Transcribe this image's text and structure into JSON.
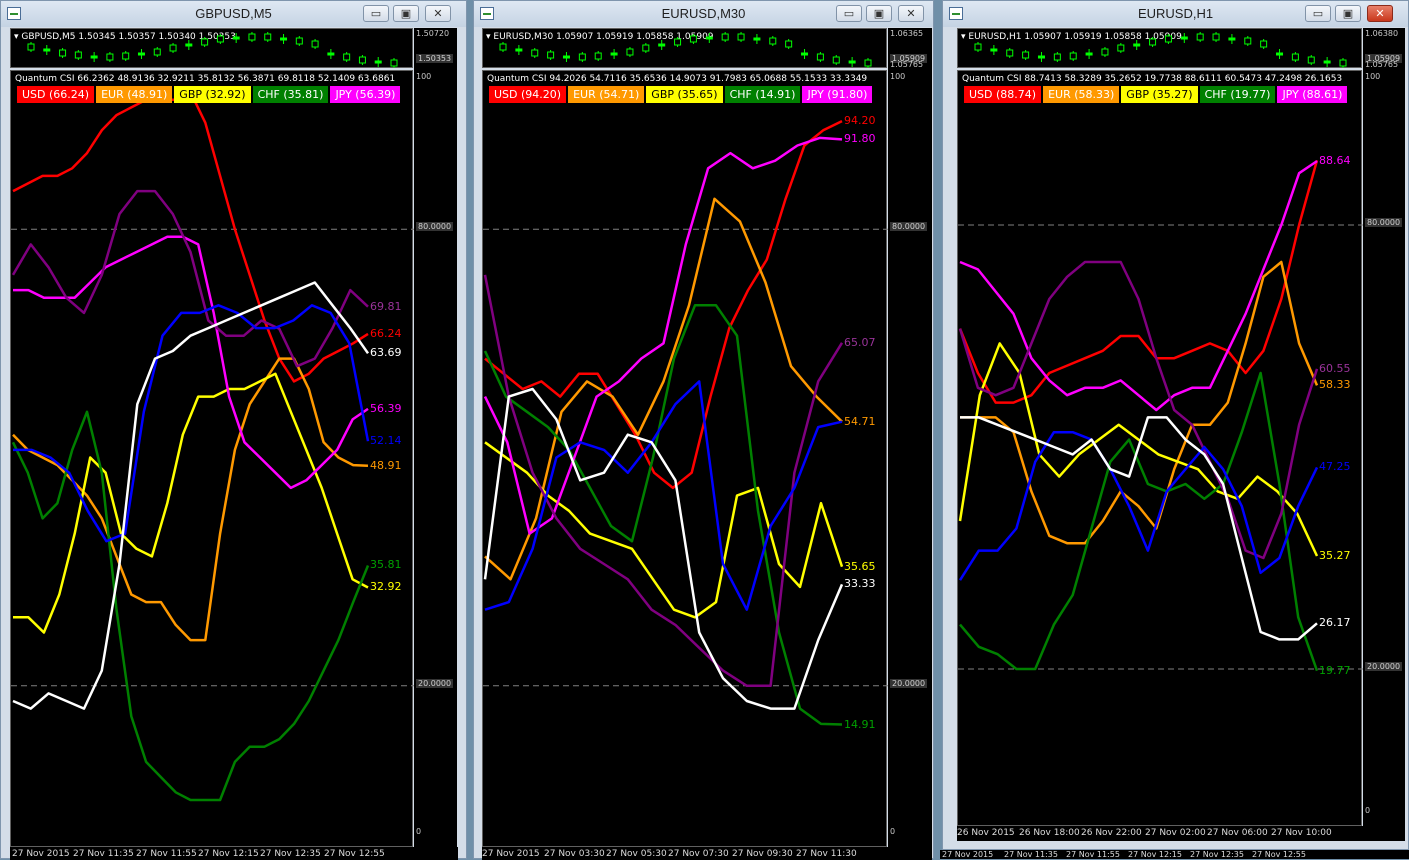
{
  "windows": [
    {
      "title": "GBPUSD,M5",
      "symbol_line": "GBPUSD,M5  1.50345 1.50357 1.50340 1.50353",
      "price_scale": [
        "1.50720",
        "1.50353"
      ],
      "csi_line": "Quantum CSI 66.2362 48.9136 32.9211 35.8132 56.3871 69.8118 52.1409 63.6861",
      "legend": [
        {
          "label": "USD (66.24)",
          "bg": "#ff0000",
          "fg": "#ffffff"
        },
        {
          "label": "EUR (48.91)",
          "bg": "#ff9900",
          "fg": "#ffffff"
        },
        {
          "label": "GBP (32.92)",
          "bg": "#ffff00",
          "fg": "#000000"
        },
        {
          "label": "CHF (35.81)",
          "bg": "#008000",
          "fg": "#ffffff"
        },
        {
          "label": "JPY (56.39)",
          "bg": "#ff00ff",
          "fg": "#ffffff"
        }
      ],
      "scale_labels": {
        "top": "100",
        "upper": "80.0000",
        "lower": "20.0000",
        "bottom": "0"
      },
      "x_ticks": [
        "27 Nov 2015",
        "27 Nov 11:35",
        "27 Nov 11:55",
        "27 Nov 12:15",
        "27 Nov 12:35",
        "27 Nov 12:55"
      ],
      "end_labels": [
        {
          "text": "69.81",
          "color": "#993399"
        },
        {
          "text": "66.24",
          "color": "#ff0000"
        },
        {
          "text": "63.69",
          "color": "#ffffff"
        },
        {
          "text": "56.39",
          "color": "#ff00ff"
        },
        {
          "text": "52.14",
          "color": "#0000ff"
        },
        {
          "text": "48.91",
          "color": "#ff9900"
        },
        {
          "text": "35.81",
          "color": "#00a000"
        },
        {
          "text": "32.92",
          "color": "#ffff00"
        }
      ]
    },
    {
      "title": "EURUSD,M30",
      "symbol_line": "EURUSD,M30  1.05907 1.05919 1.05858 1.05909",
      "price_scale": [
        "1.06365",
        "1.05909",
        "1.05765"
      ],
      "csi_line": "Quantum CSI 94.2026 54.7116 35.6536 14.9073 91.7983 65.0688 55.1533 33.3349",
      "legend": [
        {
          "label": "USD (94.20)",
          "bg": "#ff0000",
          "fg": "#ffffff"
        },
        {
          "label": "EUR (54.71)",
          "bg": "#ff9900",
          "fg": "#ffffff"
        },
        {
          "label": "GBP (35.65)",
          "bg": "#ffff00",
          "fg": "#000000"
        },
        {
          "label": "CHF (14.91)",
          "bg": "#008000",
          "fg": "#ffffff"
        },
        {
          "label": "JPY (91.80)",
          "bg": "#ff00ff",
          "fg": "#ffffff"
        }
      ],
      "scale_labels": {
        "top": "100",
        "upper": "80.0000",
        "lower": "20.0000",
        "bottom": "0"
      },
      "x_ticks": [
        "27 Nov 2015",
        "27 Nov 03:30",
        "27 Nov 05:30",
        "27 Nov 07:30",
        "27 Nov 09:30",
        "27 Nov 11:30"
      ],
      "end_labels": [
        {
          "text": "94.20",
          "color": "#ff0000"
        },
        {
          "text": "91.80",
          "color": "#ff00ff"
        },
        {
          "text": "65.07",
          "color": "#993399"
        },
        {
          "text": "54.71",
          "color": "#ff9900"
        },
        {
          "text": "35.65",
          "color": "#ffff00"
        },
        {
          "text": "33.33",
          "color": "#ffffff"
        },
        {
          "text": "14.91",
          "color": "#00a000"
        }
      ]
    },
    {
      "title": "EURUSD,H1",
      "symbol_line": "EURUSD,H1  1.05907 1.05919 1.05858 1.05909",
      "price_scale": [
        "1.06380",
        "1.05909",
        "1.05765"
      ],
      "csi_line": "Quantum CSI 88.7413 58.3289 35.2652 19.7738 88.6111 60.5473 47.2498 26.1653",
      "legend": [
        {
          "label": "USD (88.74)",
          "bg": "#ff0000",
          "fg": "#ffffff"
        },
        {
          "label": "EUR (58.33)",
          "bg": "#ff9900",
          "fg": "#ffffff"
        },
        {
          "label": "GBP (35.27)",
          "bg": "#ffff00",
          "fg": "#000000"
        },
        {
          "label": "CHF (19.77)",
          "bg": "#008000",
          "fg": "#ffffff"
        },
        {
          "label": "JPY (88.61)",
          "bg": "#ff00ff",
          "fg": "#ffffff"
        }
      ],
      "scale_labels": {
        "top": "100",
        "upper": "80.0000",
        "lower": "20.0000",
        "bottom": "0"
      },
      "x_ticks": [
        "26 Nov 2015",
        "26 Nov 18:00",
        "26 Nov 22:00",
        "27 Nov 02:00",
        "27 Nov 06:00",
        "27 Nov 10:00"
      ],
      "end_labels": [
        {
          "text": "88.64",
          "color": "#ff00ff"
        },
        {
          "text": "60.55",
          "color": "#993399"
        },
        {
          "text": "58.33",
          "color": "#ff9900"
        },
        {
          "text": "47.25",
          "color": "#0000ff"
        },
        {
          "text": "35.27",
          "color": "#ffff00"
        },
        {
          "text": "26.17",
          "color": "#ffffff"
        },
        {
          "text": "19.77",
          "color": "#00a000"
        }
      ]
    }
  ],
  "bottom_strip_ticks": [
    "27 Nov 2015",
    "27 Nov 11:35",
    "27 Nov 11:55",
    "27 Nov 12:15",
    "27 Nov 12:35",
    "27 Nov 12:55"
  ],
  "window_buttons": {
    "minimize": "▭",
    "restore": "▣",
    "close": "✕"
  },
  "chart_data": [
    {
      "type": "line",
      "ylim": [
        0,
        100
      ],
      "reference_lines": [
        80,
        20
      ],
      "series_colors": [
        "#ff0000",
        "#ff9900",
        "#ffff00",
        "#008000",
        "#ff00ff",
        "#800080",
        "#0000ff",
        "#ffffff"
      ],
      "series": [
        {
          "name": "USD",
          "values": [
            85,
            86,
            87,
            87,
            88,
            90,
            93,
            95,
            96,
            97,
            97,
            97,
            98,
            94,
            87,
            80,
            74,
            68,
            63,
            60,
            61,
            63,
            64,
            65,
            66.24
          ]
        },
        {
          "name": "EUR",
          "values": [
            53,
            51,
            50,
            49,
            47,
            45,
            42,
            37,
            32,
            31,
            31,
            28,
            26,
            26,
            40,
            51,
            57,
            60,
            63,
            63,
            59,
            52,
            50,
            49,
            48.91
          ]
        },
        {
          "name": "GBP",
          "values": [
            29,
            29,
            27,
            32,
            40,
            50,
            48,
            40,
            38,
            37,
            44,
            53,
            58,
            58,
            59,
            59,
            60,
            61,
            56,
            51,
            46,
            40,
            34,
            32.92
          ]
        },
        {
          "name": "CHF",
          "values": [
            52,
            48,
            42,
            44,
            51,
            56,
            48,
            30,
            16,
            10,
            8,
            6,
            5,
            5,
            5,
            10,
            12,
            12,
            13,
            15,
            18,
            22,
            26,
            31,
            35.81
          ]
        },
        {
          "name": "JPY",
          "values": [
            72,
            72,
            71,
            71,
            71,
            73,
            75,
            76,
            77,
            78,
            79,
            79,
            78,
            69,
            58,
            52,
            50,
            48,
            46,
            47,
            49,
            51,
            55,
            56.39
          ]
        },
        {
          "name": "Purple",
          "values": [
            74,
            78,
            75,
            71,
            69,
            74,
            82,
            85,
            85,
            82,
            77,
            68,
            66,
            66,
            68,
            66.91,
            62,
            63,
            67,
            72,
            69.81
          ]
        },
        {
          "name": "Blue",
          "values": [
            51,
            51,
            50,
            48,
            43,
            39,
            40,
            56,
            66,
            69,
            69,
            70,
            69,
            67,
            67,
            68,
            70,
            69,
            65,
            52.14
          ]
        },
        {
          "name": "White",
          "values": [
            18,
            17,
            19,
            18,
            17,
            22,
            36,
            57,
            63,
            64,
            66,
            67,
            68,
            69,
            70,
            71,
            72,
            73,
            70,
            67,
            63.69
          ]
        }
      ]
    },
    {
      "type": "line",
      "ylim": [
        0,
        100
      ],
      "reference_lines": [
        80,
        20
      ],
      "series_colors": [
        "#ff0000",
        "#ff9900",
        "#ffff00",
        "#008000",
        "#ff00ff",
        "#800080",
        "#0000ff",
        "#ffffff"
      ],
      "series": [
        {
          "name": "USD",
          "values": [
            63,
            61,
            59,
            60,
            58,
            61,
            61,
            57,
            53,
            48,
            46,
            48,
            58,
            67,
            72,
            76,
            84,
            91,
            93,
            94.2
          ]
        },
        {
          "name": "EUR",
          "values": [
            37,
            34,
            42,
            56,
            60,
            58,
            53,
            60,
            70,
            84,
            81,
            73,
            62,
            58,
            54.71
          ]
        },
        {
          "name": "GBP",
          "values": [
            52,
            50,
            48,
            45,
            43,
            40,
            39,
            38,
            34,
            30,
            29,
            31,
            45,
            46,
            36,
            33,
            44,
            35.65
          ]
        },
        {
          "name": "CHF",
          "values": [
            64,
            58,
            56,
            54,
            51,
            46,
            41,
            39,
            50,
            63,
            70,
            70,
            66,
            43,
            27,
            17,
            15,
            14.91
          ]
        },
        {
          "name": "JPY",
          "values": [
            58,
            52,
            40,
            42,
            50,
            58,
            60,
            63,
            65,
            78,
            88,
            90,
            88,
            89,
            91,
            92,
            91.8
          ]
        },
        {
          "name": "Purple",
          "values": [
            74,
            58,
            48,
            42,
            38,
            36,
            34,
            30,
            28,
            25,
            22,
            20,
            20,
            48,
            60,
            65.07
          ]
        },
        {
          "name": "Blue",
          "values": [
            30,
            31,
            38,
            50,
            52,
            51,
            48,
            52,
            57,
            60,
            36,
            30,
            41,
            46,
            54,
            54.71
          ]
        },
        {
          "name": "White",
          "values": [
            34,
            58,
            59,
            55,
            47,
            48,
            53,
            52,
            47,
            27,
            21,
            18,
            17,
            17,
            26,
            33.33
          ]
        }
      ]
    },
    {
      "type": "line",
      "ylim": [
        0,
        100
      ],
      "reference_lines": [
        80,
        20
      ],
      "series_colors": [
        "#ff0000",
        "#ff9900",
        "#ffff00",
        "#008000",
        "#ff00ff",
        "#800080",
        "#0000ff",
        "#ffffff"
      ],
      "series": [
        {
          "name": "USD",
          "values": [
            66,
            60,
            56,
            56,
            57,
            60,
            61,
            62,
            63,
            65,
            65,
            62,
            62,
            63,
            64,
            63,
            60,
            63,
            70,
            80,
            88.74
          ]
        },
        {
          "name": "EUR",
          "values": [
            54,
            54,
            54,
            52,
            44,
            38,
            37,
            37,
            40,
            44,
            42,
            39,
            47,
            53,
            53,
            56,
            64,
            73,
            75,
            64,
            58.33
          ]
        },
        {
          "name": "GBP",
          "values": [
            40,
            57,
            64,
            60,
            49,
            46,
            49,
            51,
            53,
            51,
            49,
            48,
            47,
            44,
            43,
            46,
            44,
            41,
            35.27
          ]
        },
        {
          "name": "CHF",
          "values": [
            26,
            23,
            22,
            20,
            20,
            26,
            30,
            39,
            48,
            51,
            45,
            44,
            45,
            43,
            45,
            52,
            60,
            45,
            27,
            19.77
          ]
        },
        {
          "name": "JPY",
          "values": [
            75,
            74,
            71,
            68,
            62,
            59,
            57,
            58,
            58,
            59,
            57,
            55,
            57,
            58,
            58,
            63,
            68,
            74,
            80,
            87,
            88.64
          ]
        },
        {
          "name": "Purple",
          "values": [
            66,
            58,
            57,
            58,
            64,
            70,
            73,
            75,
            75,
            75,
            70,
            62,
            55,
            53,
            48,
            43,
            36,
            35,
            41,
            53,
            60.55
          ]
        },
        {
          "name": "Blue",
          "values": [
            32,
            36,
            36,
            39,
            48,
            52,
            52,
            51,
            47,
            42,
            36,
            44,
            47,
            50,
            47,
            42,
            33,
            35,
            42,
            47.25
          ]
        },
        {
          "name": "White",
          "values": [
            54,
            54,
            53,
            52,
            51,
            50,
            49,
            51,
            47,
            46,
            54,
            54,
            51,
            49,
            45,
            35,
            25,
            24,
            24,
            26.17
          ]
        }
      ]
    }
  ]
}
